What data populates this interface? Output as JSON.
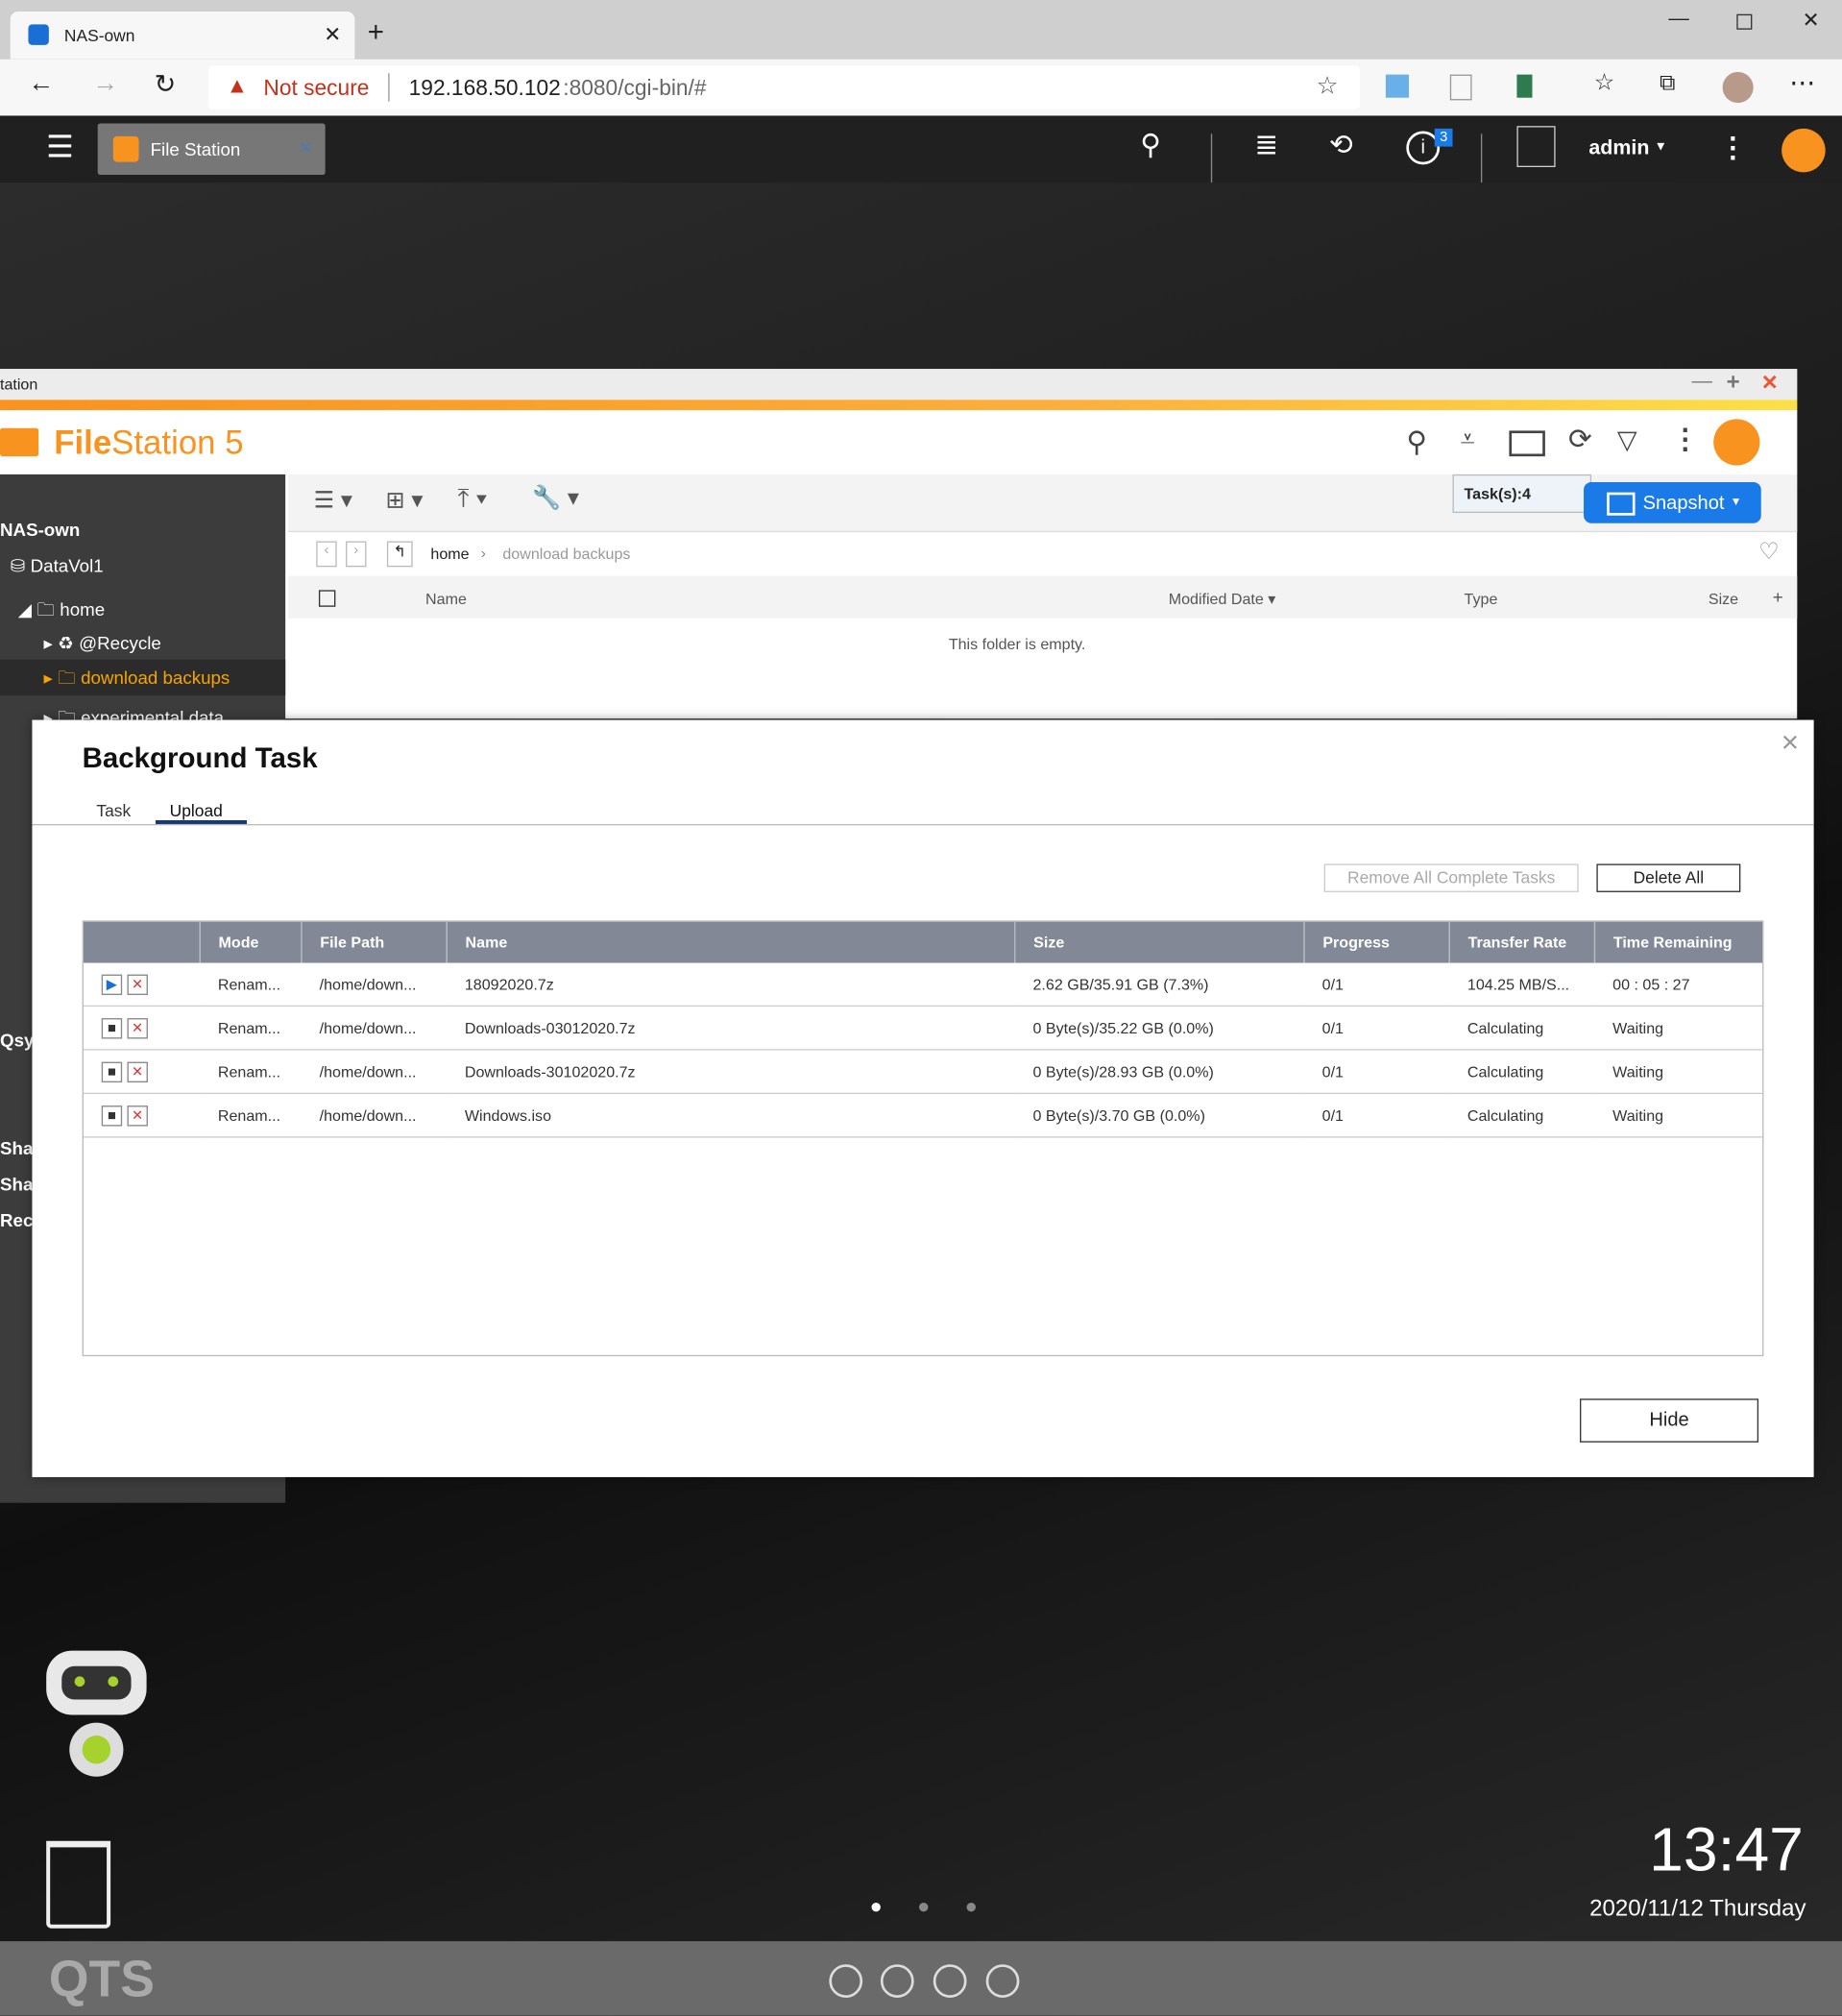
{
  "browser": {
    "tab_title": "NAS-own",
    "security": "Not secure",
    "url_host": "192.168.50.102",
    "url_rest": ":8080/cgi-bin/#"
  },
  "qts": {
    "app_tab": "File Station",
    "notification_count": "3",
    "user": "admin"
  },
  "filestation": {
    "window_title": "tation",
    "logo_bold": "File",
    "logo_rest": "Station 5",
    "tooltip": "Task(s):4",
    "snapshot_label": "Snapshot",
    "breadcrumb": [
      "home",
      "download backups"
    ],
    "columns": [
      "Name",
      "Modified Date",
      "Type",
      "Size"
    ],
    "empty_text": "This folder is empty.",
    "tree": {
      "root": "NAS-own",
      "volume": "DataVol1",
      "home": "home",
      "items": [
        "@Recycle",
        "download backups",
        "experimental data"
      ],
      "partial": [
        "Qsyn",
        "Shar",
        "Shar",
        "Rec"
      ]
    }
  },
  "dialog": {
    "title": "Background Task",
    "tabs": [
      "Task",
      "Upload"
    ],
    "active_tab": "Upload",
    "remove_complete": "Remove All Complete Tasks",
    "delete_all": "Delete All",
    "hide": "Hide",
    "columns": [
      "Mode",
      "File Path",
      "Name",
      "Size",
      "Progress",
      "Transfer Rate",
      "Time Remaining"
    ],
    "rows": [
      {
        "state": "playing",
        "mode": "Renam...",
        "path": "/home/down...",
        "name": "18092020.7z",
        "size": "2.62 GB/35.91 GB (7.3%)",
        "progress": "0/1",
        "rate": "104.25 MB/S...",
        "remaining": "00 : 05 : 27"
      },
      {
        "state": "stopped",
        "mode": "Renam...",
        "path": "/home/down...",
        "name": "Downloads-03012020.7z",
        "size": "0 Byte(s)/35.22 GB (0.0%)",
        "progress": "0/1",
        "rate": "Calculating",
        "remaining": "Waiting"
      },
      {
        "state": "stopped",
        "mode": "Renam...",
        "path": "/home/down...",
        "name": "Downloads-30102020.7z",
        "size": "0 Byte(s)/28.93 GB (0.0%)",
        "progress": "0/1",
        "rate": "Calculating",
        "remaining": "Waiting"
      },
      {
        "state": "stopped",
        "mode": "Renam...",
        "path": "/home/down...",
        "name": "Windows.iso",
        "size": "0 Byte(s)/3.70 GB (0.0%)",
        "progress": "0/1",
        "rate": "Calculating",
        "remaining": "Waiting"
      }
    ]
  },
  "desktop": {
    "time": "13:47",
    "date": "2020/11/12 Thursday",
    "brand": "QTS"
  },
  "colors": {
    "accent_orange": "#f7931e",
    "snapshot_blue": "#1a7ae8",
    "header_grey": "#838897"
  }
}
